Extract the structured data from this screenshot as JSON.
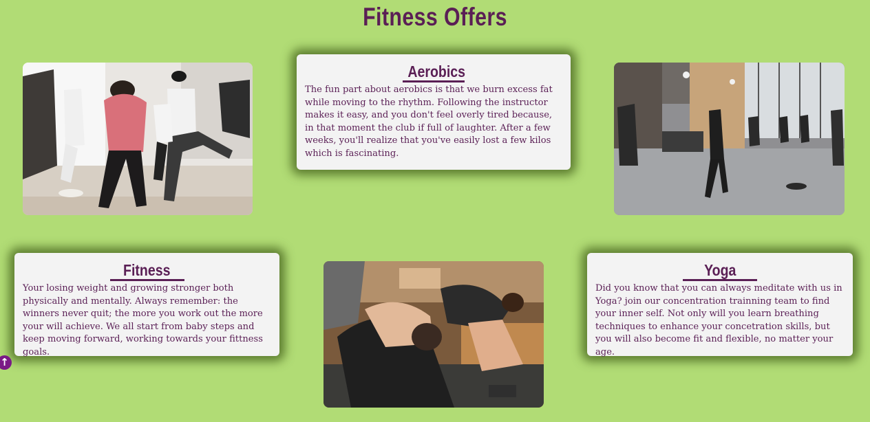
{
  "page": {
    "title": "Fitness Offers"
  },
  "offers": [
    {
      "title": "Aerobics",
      "text": "The fun part about aerobics is that we burn excess fat while moving to the rhythm. Following the instructor makes it easy, and you don't feel overly tired because, in that moment the club if full of laughter. After a few weeks, you'll realize that you've easily lost a few kilos which is fascinating."
    },
    {
      "title": "Fitness",
      "text": "Your losing weight and growing stronger both physically and mentally. Always remember: the winners never quit; the more you work out the more your will achieve. We all start from baby steps and keep moving forward, working towards your fittness goals."
    },
    {
      "title": "Yoga",
      "text": "Did you know that you can always meditate with us in Yoga? join our concentration trainning team to find your inner self. Not only will you learn breathing techniques to enhance your concetration skills, but you will also become fit and flexible, no matter your age."
    }
  ],
  "icons": {
    "scroll_top": "arrow-up-circle-icon",
    "scroll_top_glyph": "↑"
  },
  "colors": {
    "background": "#b1dc75",
    "accent": "#5a1f55",
    "card": "#f3f3f3"
  }
}
